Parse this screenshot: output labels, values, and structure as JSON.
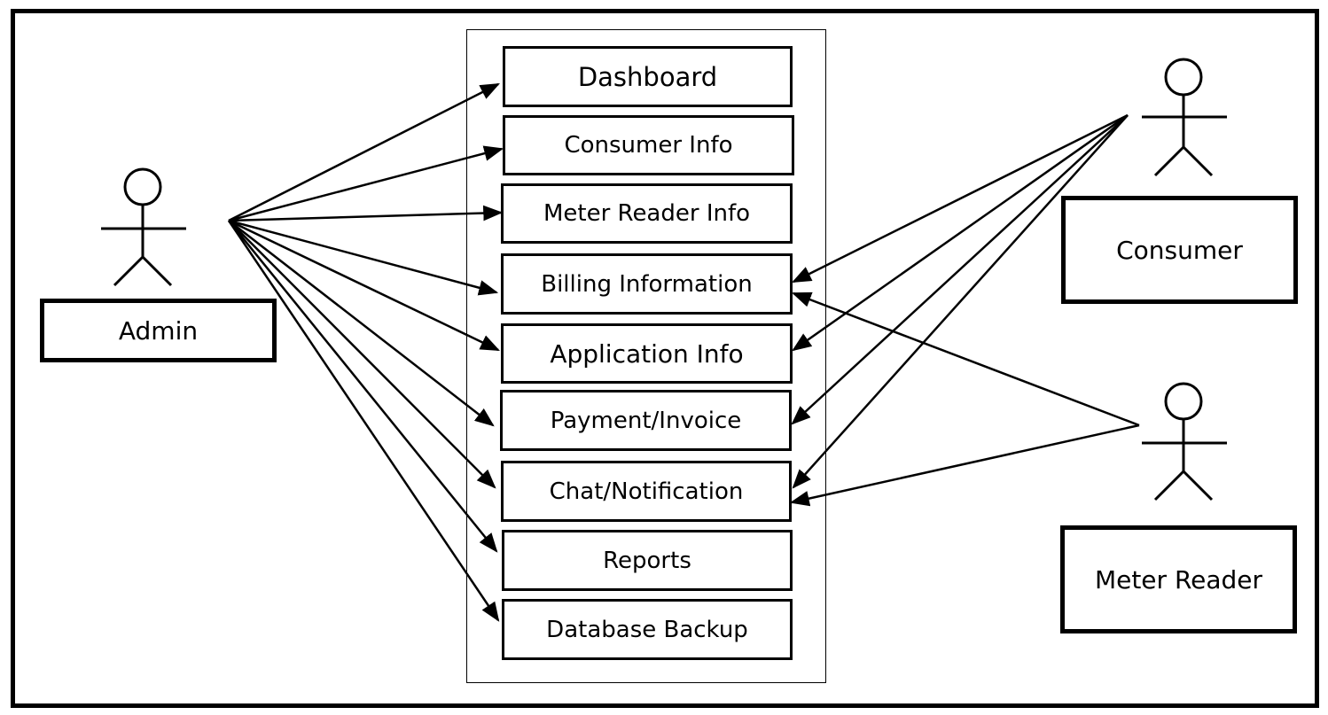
{
  "diagram": {
    "type": "use-case",
    "colors": {
      "stroke": "#000000",
      "background": "#ffffff"
    },
    "actors": [
      {
        "id": "admin",
        "label": "Admin"
      },
      {
        "id": "consumer",
        "label": "Consumer"
      },
      {
        "id": "meter_reader",
        "label": "Meter Reader"
      }
    ],
    "use_cases": [
      {
        "id": "dashboard",
        "label": "Dashboard"
      },
      {
        "id": "consumer_info",
        "label": "Consumer Info"
      },
      {
        "id": "meter_reader_info",
        "label": "Meter Reader Info"
      },
      {
        "id": "billing_information",
        "label": "Billing Information"
      },
      {
        "id": "application_info",
        "label": "Application Info"
      },
      {
        "id": "payment_invoice",
        "label": "Payment/Invoice"
      },
      {
        "id": "chat_notification",
        "label": "Chat/Notification"
      },
      {
        "id": "reports",
        "label": "Reports"
      },
      {
        "id": "database_backup",
        "label": "Database Backup"
      }
    ],
    "associations": [
      {
        "from": "admin",
        "to": "dashboard"
      },
      {
        "from": "admin",
        "to": "consumer_info"
      },
      {
        "from": "admin",
        "to": "meter_reader_info"
      },
      {
        "from": "admin",
        "to": "billing_information"
      },
      {
        "from": "admin",
        "to": "application_info"
      },
      {
        "from": "admin",
        "to": "payment_invoice"
      },
      {
        "from": "admin",
        "to": "chat_notification"
      },
      {
        "from": "admin",
        "to": "reports"
      },
      {
        "from": "admin",
        "to": "database_backup"
      },
      {
        "from": "consumer",
        "to": "billing_information"
      },
      {
        "from": "consumer",
        "to": "application_info"
      },
      {
        "from": "consumer",
        "to": "payment_invoice"
      },
      {
        "from": "consumer",
        "to": "chat_notification"
      },
      {
        "from": "meter_reader",
        "to": "billing_information"
      },
      {
        "from": "meter_reader",
        "to": "chat_notification"
      }
    ]
  }
}
